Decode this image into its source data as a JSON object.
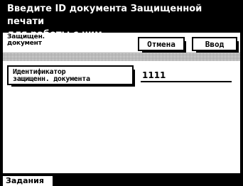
{
  "header": {
    "line1": "Введите ID документа Защищенной печати",
    "line2": "для работы с ним."
  },
  "panel": {
    "mode_label_line1": "Защищен.",
    "mode_label_line2": "документ",
    "cancel_label": "Отмена",
    "enter_label": "Ввод"
  },
  "id_button": {
    "line1": "Идентификатор",
    "line2": "защищенн. документа"
  },
  "id_field": {
    "value": "1111"
  },
  "tabs": {
    "jobs_label": "Задания"
  }
}
